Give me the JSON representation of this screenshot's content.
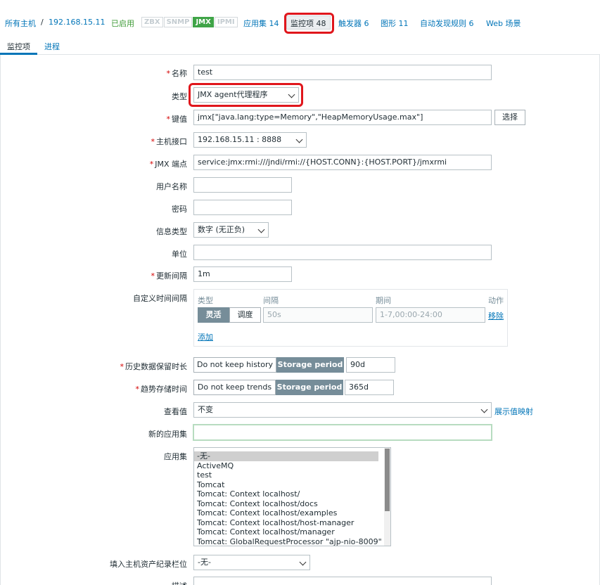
{
  "nav": {
    "all_hosts": "所有主机",
    "separator": "/",
    "host": "192.168.15.11",
    "status": "已启用",
    "availability": [
      {
        "label": "ZBX",
        "active": false
      },
      {
        "label": "SNMP",
        "active": false
      },
      {
        "label": "JMX",
        "active": true
      },
      {
        "label": "IPMI",
        "active": false
      }
    ],
    "tabs": {
      "applications": "应用集 14",
      "items": "监控项 48",
      "triggers": "触发器 6",
      "graphs": "图形 11",
      "discovery": "自动发现规则 6",
      "web": "Web 场景"
    }
  },
  "subtabs": {
    "items": "监控项",
    "process": "进程"
  },
  "form": {
    "required_mark": "*",
    "name": {
      "label": "名称",
      "value": "test"
    },
    "type": {
      "label": "类型",
      "value": "JMX agent代理程序"
    },
    "key": {
      "label": "键值",
      "value": "jmx[\"java.lang:type=Memory\",\"HeapMemoryUsage.max\"]",
      "button": "选择"
    },
    "interface": {
      "label": "主机接口",
      "value": "192.168.15.11 : 8888"
    },
    "jmx_endpoint": {
      "label": "JMX 端点",
      "value": "service:jmx:rmi:///jndi/rmi://{HOST.CONN}:{HOST.PORT}/jmxrmi"
    },
    "username": {
      "label": "用户名称",
      "value": ""
    },
    "password": {
      "label": "密码",
      "value": ""
    },
    "info_type": {
      "label": "信息类型",
      "value": "数字 (无正负)"
    },
    "units": {
      "label": "单位",
      "value": ""
    },
    "update_interval": {
      "label": "更新间隔",
      "value": "1m"
    },
    "custom_intervals": {
      "label": "自定义时间间隔",
      "headers": {
        "type": "类型",
        "interval": "间隔",
        "period": "期间",
        "action": "动作"
      },
      "row": {
        "flexible": "灵活",
        "scheduling": "调度",
        "interval_placeholder": "50s",
        "period_placeholder": "1-7,00:00-24:00",
        "remove": "移除"
      },
      "add": "添加"
    },
    "history": {
      "label": "历史数据保留时长",
      "option_off": "Do not keep history",
      "option_on": "Storage period",
      "value": "90d"
    },
    "trends": {
      "label": "趋势存储时间",
      "option_off": "Do not keep trends",
      "option_on": "Storage period",
      "value": "365d"
    },
    "show_value": {
      "label": "查看值",
      "value": "不变",
      "link": "展示值映射"
    },
    "new_application": {
      "label": "新的应用集",
      "value": ""
    },
    "applications": {
      "label": "应用集",
      "items": [
        "-无-",
        "ActiveMQ",
        "test",
        "Tomcat",
        "Tomcat: Context localhost/",
        "Tomcat: Context localhost/docs",
        "Tomcat: Context localhost/examples",
        "Tomcat: Context localhost/host-manager",
        "Tomcat: Context localhost/manager",
        "Tomcat: GlobalRequestProcessor \"ajp-nio-8009\""
      ]
    },
    "inventory": {
      "label": "填入主机资产纪录栏位",
      "value": "-无-"
    },
    "description": {
      "label": "描述"
    }
  }
}
